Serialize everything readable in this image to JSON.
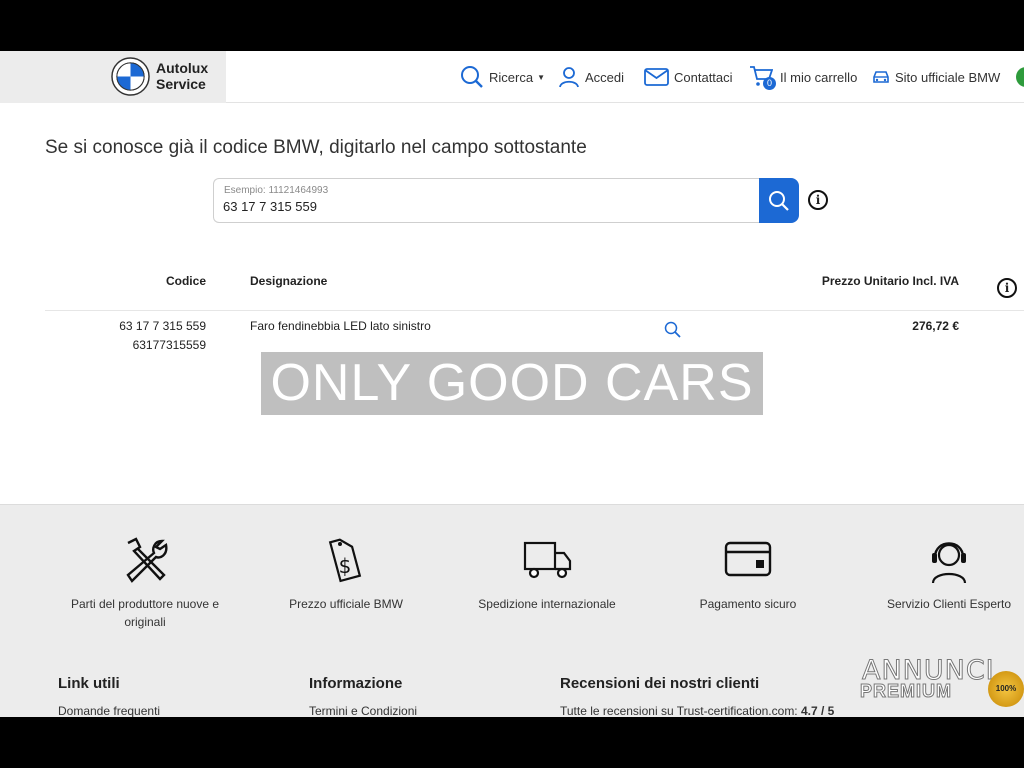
{
  "header": {
    "brand_line1": "Autolux",
    "brand_line2": "Service",
    "nav": {
      "ricerca": "Ricerca",
      "accedi": "Accedi",
      "contatti": "Contattaci",
      "carrello": "Il mio carrello",
      "cart_count": "0",
      "sito": "Sito ufficiale BMW"
    }
  },
  "search": {
    "instruction": "Se si conosce già il codice BMW, digitarlo nel campo sottostante",
    "hint": "Esempio: 11121464993",
    "value": "63 17 7 315 559"
  },
  "table": {
    "headers": {
      "code": "Codice",
      "designation": "Designazione",
      "price": "Prezzo Unitario Incl. IVA"
    },
    "rows": [
      {
        "code": "63 17 7 315 559",
        "code_compact": "63177315559",
        "designation": "Faro fendinebbia LED lato sinistro",
        "price": "276,72 €"
      }
    ]
  },
  "overlay": {
    "watermark": "ONLY GOOD CARS"
  },
  "features": [
    {
      "label": "Parti del produttore nuove e originali",
      "icon": "tools-icon"
    },
    {
      "label": "Prezzo ufficiale BMW",
      "icon": "price-tag-icon"
    },
    {
      "label": "Spedizione internazionale",
      "icon": "truck-icon"
    },
    {
      "label": "Pagamento sicuro",
      "icon": "card-icon"
    },
    {
      "label": "Servizio Clienti Esperto",
      "icon": "headset-icon"
    }
  ],
  "footer": {
    "col1": {
      "title": "Link utili",
      "first_link": "Domande frequenti"
    },
    "col2": {
      "title": "Informazione",
      "first_link": "Termini e Condizioni"
    },
    "col3": {
      "title": "Recensioni dei nostri clienti",
      "text": "Tutte le recensioni su Trust-certification.com:",
      "rating": "4.7 / 5"
    }
  },
  "badge": {
    "line1": "ANNUNCI",
    "line2": "PREMIUM",
    "seal": "100%"
  },
  "colors": {
    "accent": "#1c69d4",
    "features_bg": "#ececec",
    "logo_bg": "#ececec"
  }
}
